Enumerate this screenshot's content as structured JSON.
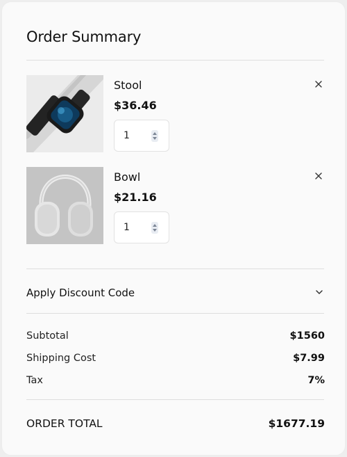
{
  "header": {
    "title": "Order Summary"
  },
  "items": [
    {
      "name": "Stool",
      "price": "$36.46",
      "quantity": "1",
      "image": "smartwatch-photo"
    },
    {
      "name": "Bowl",
      "price": "$21.16",
      "quantity": "1",
      "image": "headphones-photo"
    }
  ],
  "discount": {
    "label": "Apply Discount Code"
  },
  "summary": {
    "subtotal_label": "Subtotal",
    "subtotal_value": "$1560",
    "shipping_label": "Shipping Cost",
    "shipping_value": "$7.99",
    "tax_label": "Tax",
    "tax_value": "7%",
    "total_label": "ORDER TOTAL",
    "total_value": "$1677.19"
  },
  "icons": {
    "remove": "close-icon",
    "stepper": "up-down-arrows-icon",
    "expand": "chevron-down-icon"
  }
}
